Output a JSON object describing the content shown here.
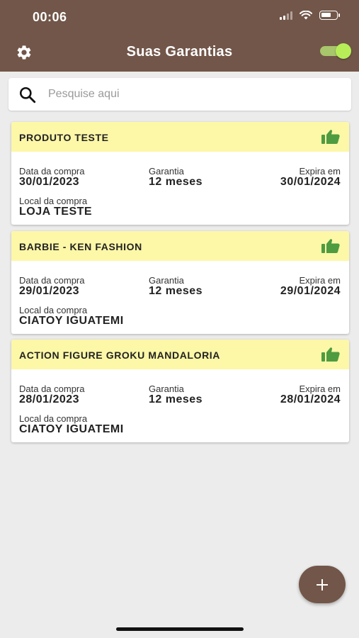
{
  "status_bar": {
    "time": "00:06",
    "battery_level": 0.7
  },
  "header": {
    "title": "Suas Garantias",
    "settings_icon": "gear-icon",
    "toggle_on": true,
    "toggle_color": "#b7ee58"
  },
  "search": {
    "placeholder": "Pesquise aqui",
    "value": ""
  },
  "labels": {
    "purchase_date": "Data da compra",
    "warranty": "Garantia",
    "expires": "Expira em",
    "store": "Local da compra"
  },
  "warranties": [
    {
      "name": "PRODUTO TESTE",
      "purchase_date": "30/01/2023",
      "warranty": "12 meses",
      "expires": "30/01/2024",
      "store": "LOJA TESTE"
    },
    {
      "name": "BARBIE - KEN FASHION",
      "purchase_date": "29/01/2023",
      "warranty": "12 meses",
      "expires": "29/01/2024",
      "store": "CIATOY IGUATEMI"
    },
    {
      "name": "ACTION FIGURE GROKU MANDALORIA",
      "purchase_date": "28/01/2023",
      "warranty": "12 meses",
      "expires": "28/01/2024",
      "store": "CIATOY IGUATEMI"
    }
  ],
  "colors": {
    "primary": "#725649",
    "card_header": "#fdf7a8",
    "thumb": "#4e9c3f"
  }
}
